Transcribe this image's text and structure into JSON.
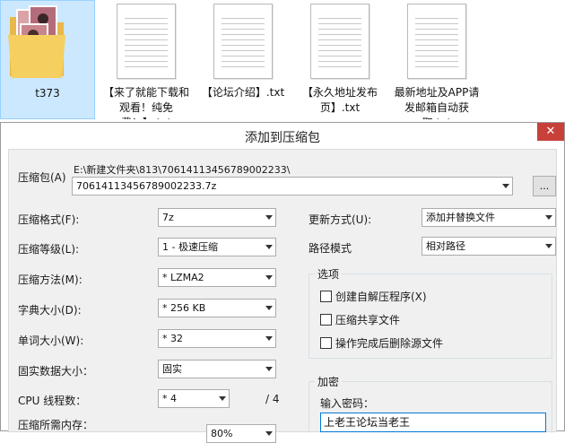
{
  "explorer": {
    "files": [
      {
        "name": "t373",
        "icon": "folder-with-thumbnails-icon"
      },
      {
        "name": "【来了就能下载和观看！纯免费！】.txt",
        "icon": "text-file-icon"
      },
      {
        "name": "【论坛介绍】.txt",
        "icon": "text-file-icon"
      },
      {
        "name": "【永久地址发布页】.txt",
        "icon": "text-file-icon"
      },
      {
        "name": "最新地址及APP请发邮箱自动获取.txt",
        "icon": "text-file-icon"
      }
    ]
  },
  "dialog": {
    "title": "添加到压缩包",
    "close_glyph": "✕",
    "archive": {
      "label": "压缩包(A)",
      "path": "E:\\新建文件夹\\813\\70614113456789002233\\",
      "filename": "70614113456789002233.7z",
      "browse_label": "..."
    },
    "format": {
      "label": "压缩格式(F):",
      "value": "7z"
    },
    "level": {
      "label": "压缩等级(L):",
      "value": "1 - 极速压缩"
    },
    "method": {
      "label": "压缩方法(M):",
      "value": "* LZMA2"
    },
    "dict_size": {
      "label": "字典大小(D):",
      "value": "* 256 KB"
    },
    "word_size": {
      "label": "单词大小(W):",
      "value": "* 32"
    },
    "solid": {
      "label": "固实数据大小：",
      "value": "固实"
    },
    "cpu": {
      "label": "CPU 线程数：",
      "value": "* 4",
      "total": "/ 4"
    },
    "memory": {
      "label": "压缩所需内存：",
      "value": "80%"
    },
    "update_mode": {
      "label": "更新方式(U):",
      "value": "添加并替换文件"
    },
    "path_mode": {
      "label": "路径模式",
      "value": "相对路径"
    },
    "options": {
      "title": "选项",
      "create_sfx": "创建自解压程序(X)",
      "compress_shared": "压缩共享文件",
      "delete_after": "操作完成后删除源文件"
    },
    "encryption": {
      "title": "加密",
      "password_label": "输入密码：",
      "password_value": "上老王论坛当老王"
    }
  },
  "colors": {
    "selection_bg": "#cce8ff",
    "close_button": "#c7403a",
    "focus_border": "#0078d7",
    "dialog_bg": "#f0f0f0"
  }
}
